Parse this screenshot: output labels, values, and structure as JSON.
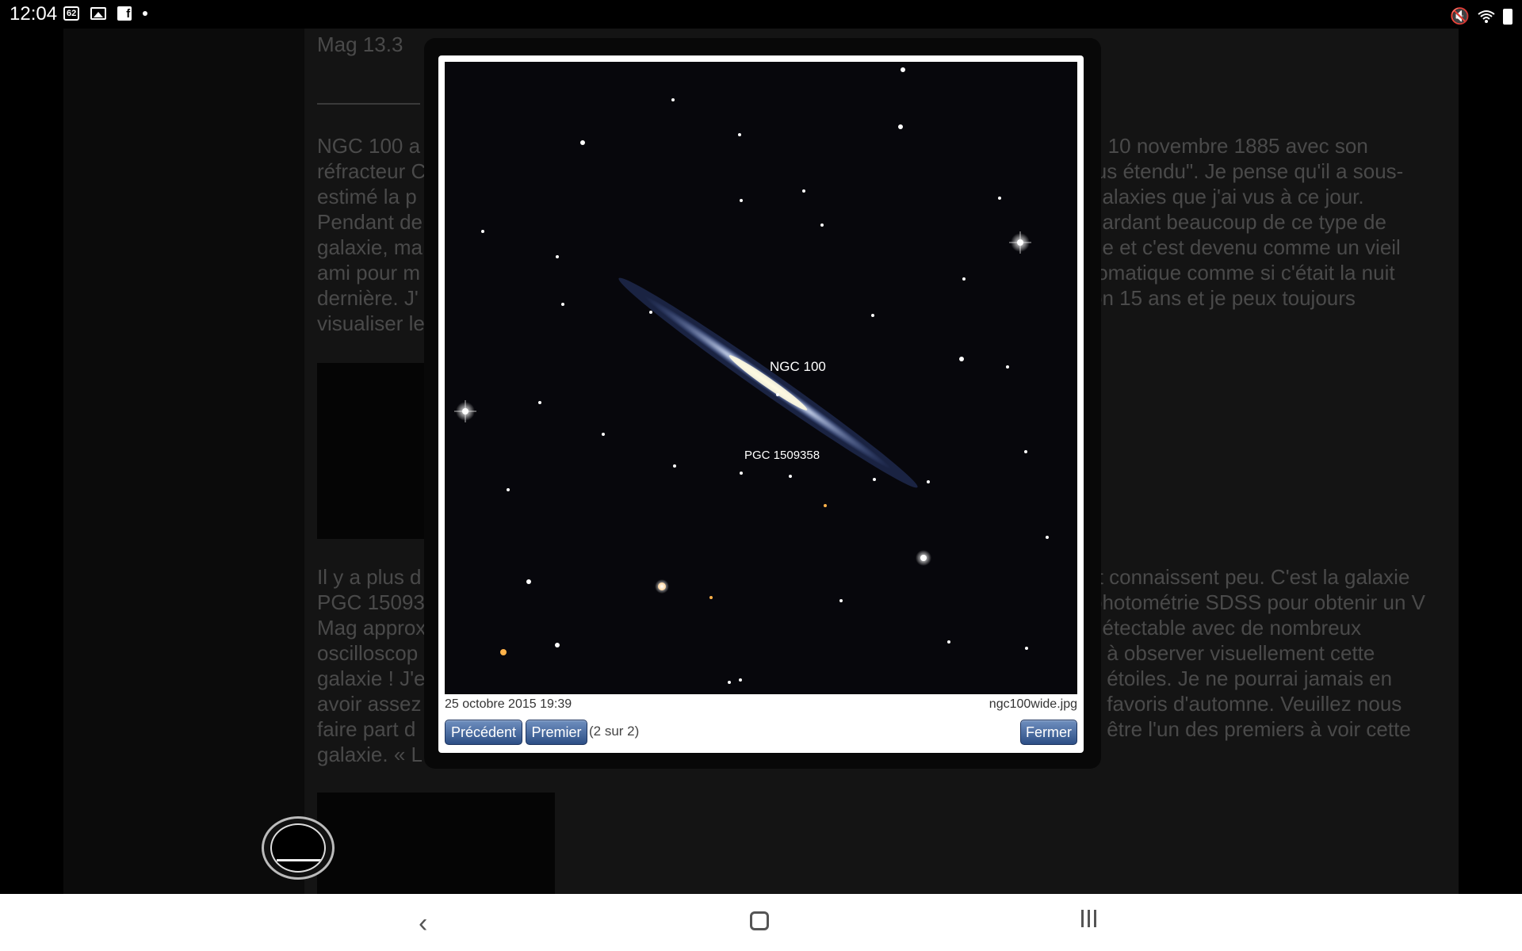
{
  "status_bar": {
    "time": "12:04",
    "notification_badge": "62",
    "icons_left": [
      "notification-62-icon",
      "gallery-icon",
      "facebook-icon",
      "dot-icon"
    ],
    "icons_right": [
      "mute-icon",
      "wifi-icon",
      "battery-icon"
    ]
  },
  "background_page": {
    "mag": "Mag 13.3",
    "paragraph1_lines": [
      "NGC 100 a",
      "réfracteur C",
      "estimé la p",
      "Pendant de",
      "galaxie, ma",
      "ami pour m",
      "dernière. J'",
      "visualiser le"
    ],
    "paragraph1_right": [
      "u 10 novembre 1885 avec son",
      "lus étendu\". Je pense qu'il a sous-",
      "galaxies que j'ai vus à ce jour.",
      "gardant beaucoup de ce type de",
      "ne et c'est devenu comme un vieil",
      "tomatique comme si c'était la nuit",
      "on 15 ans et je peux toujours"
    ],
    "paragraph2_lines": [
      "Il y a plus d",
      "PGC 15093",
      "Mag approx",
      "oscilloscop",
      "galaxie ! J'e",
      "avoir assez",
      "faire part d",
      "galaxie. « L"
    ],
    "paragraph2_right": [
      "rt connaissent peu. C'est la galaxie",
      "photométrie SDSS pour obtenir un V",
      "détectable avec de nombreux",
      "s à observer visuellement cette",
      "s étoiles. Je ne pourrai jamais en",
      "s favoris d'automne. Veuillez nous",
      "z être l'un des premiers à voir cette"
    ]
  },
  "lightbox": {
    "image_labels": {
      "galaxy": "NGC 100",
      "companion": "PGC 1509358"
    },
    "date": "25 octobre 2015 19:39",
    "filename": "ngc100wide.jpg",
    "buttons": {
      "previous": "Précédent",
      "first": "Premier",
      "close": "Fermer"
    },
    "counter": "(2 sur 2)"
  },
  "nav_bar": {
    "icons": [
      "back-icon",
      "home-icon",
      "recent-apps-icon"
    ]
  }
}
